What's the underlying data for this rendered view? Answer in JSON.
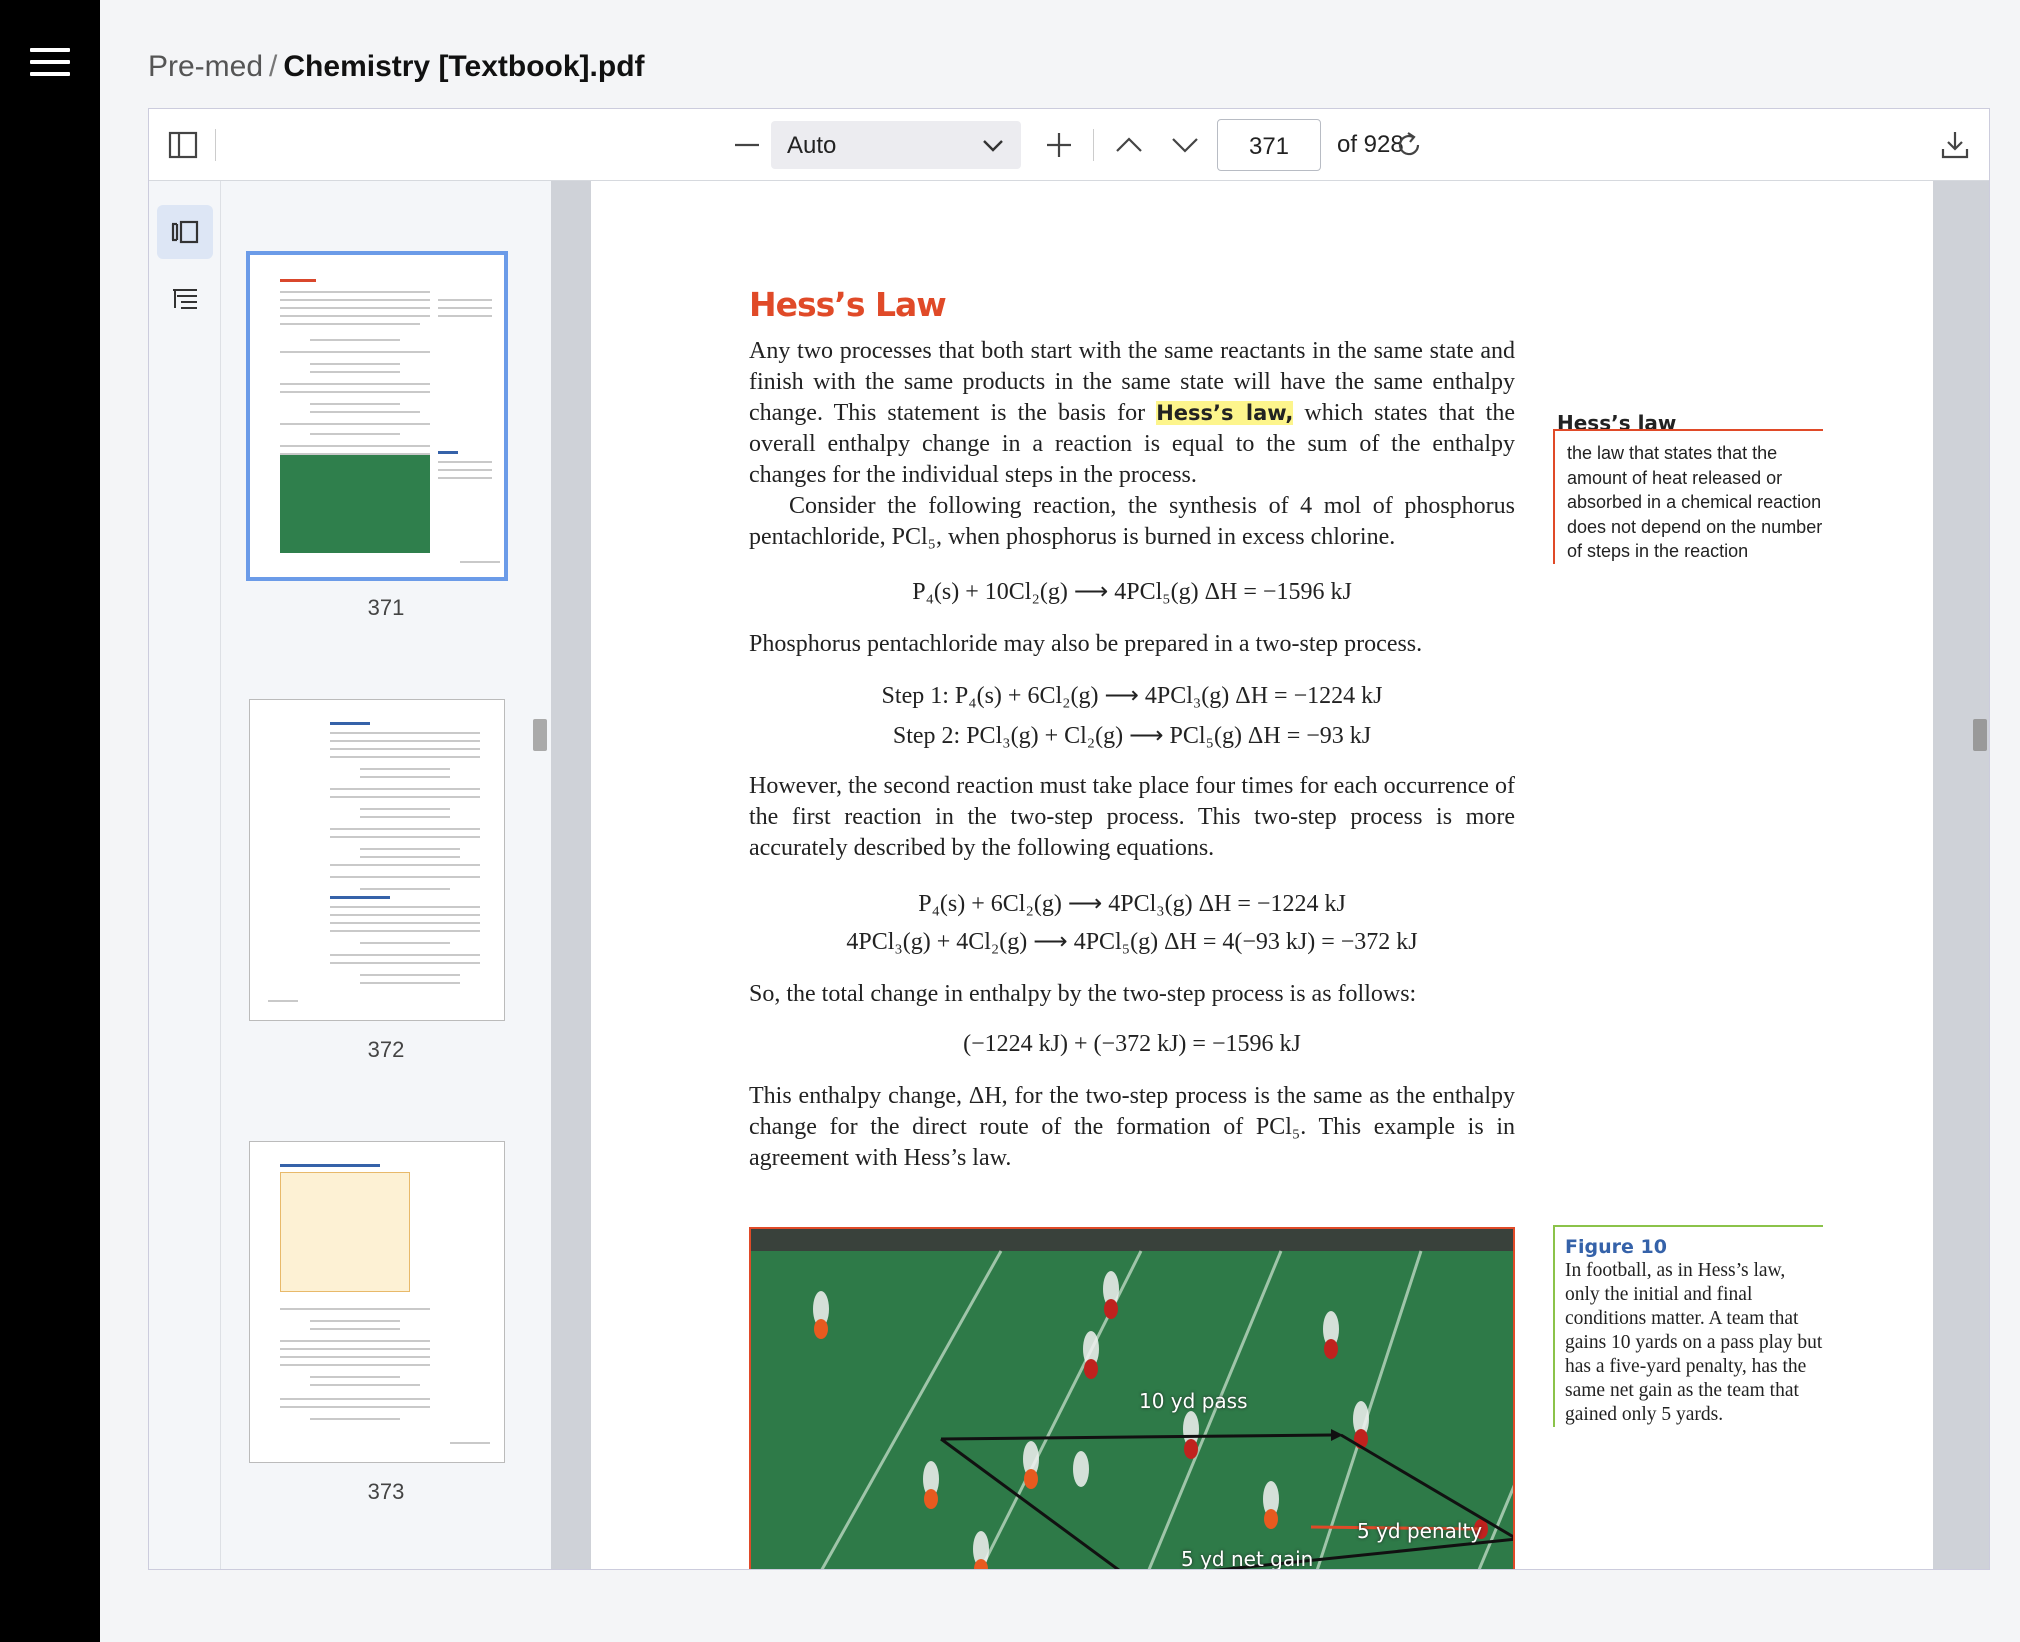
{
  "breadcrumb": {
    "folder": "Pre-med",
    "separator": "/",
    "file": "Chemistry [Textbook].pdf"
  },
  "toolbar": {
    "zoom_value": "Auto",
    "page_current": "371",
    "page_total_label": "of 928"
  },
  "thumbnails": [
    {
      "page": "371",
      "active": true
    },
    {
      "page": "372",
      "active": false
    },
    {
      "page": "373",
      "active": false
    }
  ],
  "page": {
    "title": "Hess’s Law",
    "para1_pre": "Any two processes that both start with the same reactants in the same state and finish with the same products in the same state will have the same enthalpy change. This statement is the basis for ",
    "para1_term": "Hess’s law,",
    "para1_post": " which states that the overall enthalpy change in a reaction is equal to the sum of the enthalpy changes for the individual steps in the process.",
    "para2": "Consider the following reaction, the synthesis of 4 mol of phosphorus pentachloride, PCl₅, when phosphorus is burned in excess chlorine.",
    "eq1": "P₄(s) + 10Cl₂(g) ⟶ 4PCl₅(g)    ΔH = −1596 kJ",
    "para3": "Phosphorus pentachloride may also be prepared in a two-step process.",
    "step1": "Step 1: P₄(s) + 6Cl₂(g) ⟶ 4PCl₃(g)    ΔH = −1224 kJ",
    "step2": "Step 2: PCl₃(g) + Cl₂(g) ⟶ PCl₅(g)    ΔH = −93 kJ",
    "para4": "However, the second reaction must take place four times for each occurrence of the first reaction in the two-step process. This two-step process is more accurately described by the following equations.",
    "eq2a": "P₄(s) + 6Cl₂(g) ⟶ 4PCl₃(g)    ΔH = −1224 kJ",
    "eq2b": "4PCl₃(g) + 4Cl₂(g) ⟶ 4PCl₅(g)    ΔH = 4(−93 kJ) = −372 kJ",
    "para5": "So, the total change in enthalpy by the two-step process is as follows:",
    "eq3": "(−1224 kJ) + (−372 kJ) = −1596 kJ",
    "para6": "This enthalpy change, ΔH, for the two-step process is the same as the enthalpy change for the direct route of the formation of PCl₅. This example is in agreement with Hess’s law.",
    "margin_term": "Hess’s law",
    "margin_def": "the law that states that the amount of heat released or absorbed in a chemical reaction does not depend on the number of steps in the reaction",
    "figure_number": "Figure 10",
    "figure_caption": "In football, as in Hess’s law, only the initial and final conditions matter. A team that gains 10 yards on a pass play but has a five-yard penalty, has the same net gain as the team that gained only 5 yards.",
    "fig_label_pass": "10 yd pass",
    "fig_label_penalty": "5 yd penalty",
    "fig_label_net": "5 yd net gain"
  },
  "icons": {
    "menu": "hamburger-icon",
    "sidebar_toggle": "sidebar-toggle-icon",
    "zoom_out": "minus-icon",
    "zoom_in": "plus-icon",
    "prev_page": "chevron-up-icon",
    "next_page": "chevron-down-icon",
    "rotate": "rotate-icon",
    "download": "download-icon",
    "thumbnails_tab": "thumbnails-icon",
    "outline_tab": "outline-icon"
  },
  "colors": {
    "title_red": "#e04a28",
    "highlight": "#fdf58c",
    "figure_blue": "#3562a9",
    "thumb_active": "#6b9be8",
    "field_green": "#2e7a48"
  }
}
